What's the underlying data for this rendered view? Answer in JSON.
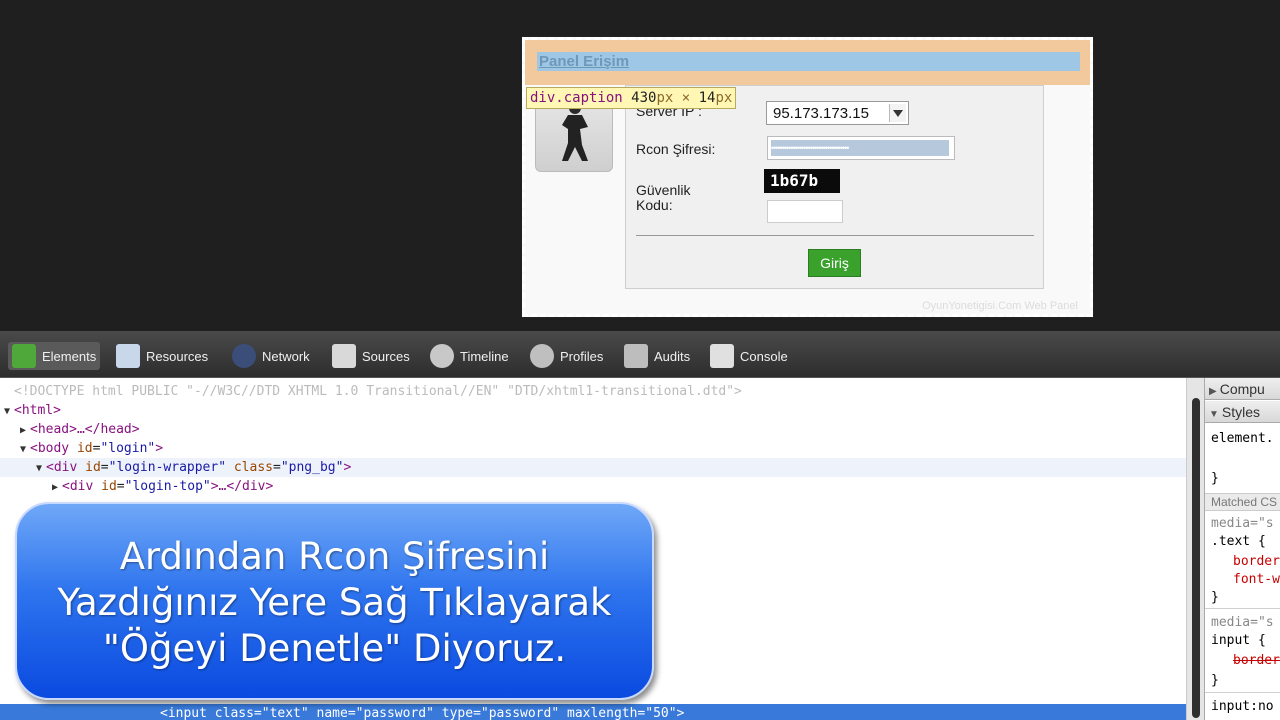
{
  "login": {
    "caption": "Panel Erişim",
    "server_label": "Server IP :",
    "server_value": "95.173.173.15",
    "rcon_label": "Rcon Şifresi:",
    "password_mask": "••••••••••••••••••••••••••••••••••••",
    "security_label_1": "Güvenlik",
    "security_label_2": "Kodu:",
    "captcha": "1b67b",
    "submit_label": "Giriş",
    "watermark": "OyunYonetigisi.Com Web Panel"
  },
  "tooltip": {
    "selector": "div.caption",
    "width": "430",
    "unit1": "px",
    "times": "×",
    "height": "14",
    "unit2": "px"
  },
  "devtools": {
    "tabs": [
      "Elements",
      "Resources",
      "Network",
      "Sources",
      "Timeline",
      "Profiles",
      "Audits",
      "Console"
    ],
    "dom": {
      "doctype": "<!DOCTYPE html PUBLIC \"-//W3C//DTD XHTML 1.0 Transitional//EN\" \"DTD/xhtml1-transitional.dtd\">",
      "html_open": "<html>",
      "head": "<head>…</head>",
      "body_tag": "<body",
      "body_attr": "id",
      "body_val": "\"login\"",
      "div_tag": "<div",
      "div_attr1": "id",
      "div_val1": "\"login-wrapper\"",
      "div_attr2": "class",
      "div_val2": "\"png_bg\"",
      "top_tag": "<div",
      "top_attr": "id",
      "top_val": "\"login-top\"",
      "top_end": ">…</div>",
      "selected_line": "<input class=\"text\" name=\"password\" type=\"password\" maxlength=\"50\">"
    },
    "side": {
      "computed": "Compu",
      "styles": "Styles",
      "element_rule": "element.",
      "close_brace": "}",
      "matched": "Matched CS",
      "media1": "media=\"s",
      "selector1": ".text {",
      "prop1": "border",
      "prop2": "font-w",
      "media2": "media=\"s",
      "selector2": "input {",
      "prop3": "border",
      "media3": "input:no"
    }
  },
  "overlay": {
    "line1": "Ardından Rcon Şifresini",
    "line2": "Yazdığınız Yere Sağ Tıklayarak",
    "line3": "\"Öğeyi Denetle\" Diyoruz."
  },
  "colors": {
    "caption_bg": "#f1c99c",
    "caption_inner": "#9ec7e6",
    "submit_green": "#3aa12c",
    "selection_blue": "#3879d9",
    "overlay_blue": "#2e74ee"
  }
}
